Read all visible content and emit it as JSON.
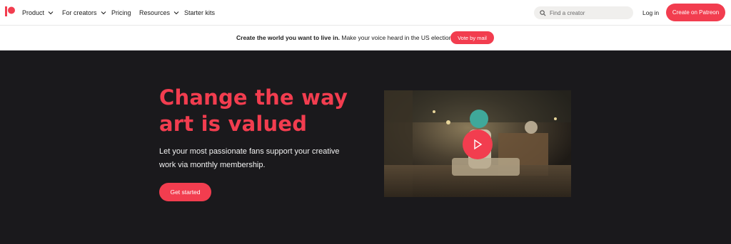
{
  "nav": {
    "items": [
      {
        "label": "Product",
        "has_dropdown": true
      },
      {
        "label": "For creators",
        "has_dropdown": true
      },
      {
        "label": "Pricing",
        "has_dropdown": false
      },
      {
        "label": "Resources",
        "has_dropdown": true
      },
      {
        "label": "Starter kits",
        "has_dropdown": false
      }
    ],
    "search_placeholder": "Find a creator",
    "login_label": "Log in",
    "create_label": "Create on Patreon"
  },
  "banner": {
    "bold_text": "Create the world you want to live in.",
    "text": " Make your voice heard in the US elections.",
    "button_label": "Vote by mail"
  },
  "hero": {
    "title_line1": "Change the way",
    "title_line2": "art is valued",
    "subtitle_line1": "Let your most passionate fans support your creative",
    "subtitle_line2": "work via monthly membership.",
    "cta_label": "Get started"
  },
  "colors": {
    "brand": "#f23d4f",
    "hero_bg": "#1a191c"
  },
  "icons": [
    "patreon-logo-icon",
    "chevron-down-icon",
    "search-icon",
    "play-icon"
  ]
}
